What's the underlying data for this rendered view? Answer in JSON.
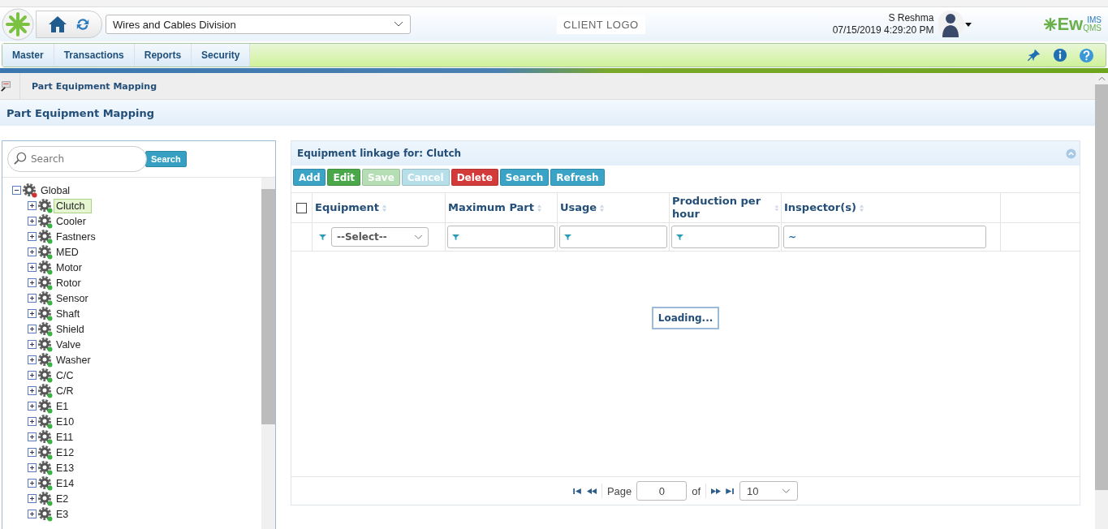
{
  "header": {
    "division": "Wires and Cables Division",
    "client_logo": "CLIENT LOGO",
    "user_name": "S Reshma",
    "datetime": "07/15/2019 4:29:20 PM",
    "brand": "Ew",
    "brand_sup": "IMS",
    "brand_sub": "QMS"
  },
  "menu": [
    "Master",
    "Transactions",
    "Reports",
    "Security"
  ],
  "breadcrumb": "Part Equipment Mapping",
  "page_title": "Part Equipment Mapping",
  "tree_panel": {
    "search": {
      "placeholder": "Search"
    },
    "search_button": "Search",
    "tree": [
      {
        "label": "Global",
        "expanded": true,
        "selected": false,
        "color": "#d03030",
        "children": [
          {
            "label": "Clutch",
            "expanded": false,
            "selected": true,
            "color": "#3cb043"
          },
          {
            "label": "Cooler",
            "expanded": false,
            "selected": false,
            "color": "#3cb043"
          },
          {
            "label": "Fastners",
            "expanded": false,
            "selected": false,
            "color": "#3cb043"
          },
          {
            "label": "MED",
            "expanded": false,
            "selected": false,
            "color": "#3cb043"
          },
          {
            "label": "Motor",
            "expanded": false,
            "selected": false,
            "color": "#3cb043"
          },
          {
            "label": "Rotor",
            "expanded": false,
            "selected": false,
            "color": "#3cb043"
          },
          {
            "label": "Sensor",
            "expanded": false,
            "selected": false,
            "color": "#3cb043"
          },
          {
            "label": "Shaft",
            "expanded": false,
            "selected": false,
            "color": "#3cb043"
          },
          {
            "label": "Shield",
            "expanded": false,
            "selected": false,
            "color": "#3cb043"
          },
          {
            "label": "Valve",
            "expanded": false,
            "selected": false,
            "color": "#3cb043"
          },
          {
            "label": "Washer",
            "expanded": false,
            "selected": false,
            "color": "#3cb043"
          },
          {
            "label": "C/C",
            "expanded": false,
            "selected": false,
            "color": "#3cb043"
          },
          {
            "label": "C/R",
            "expanded": false,
            "selected": false,
            "color": "#3cb043"
          },
          {
            "label": "E1",
            "expanded": false,
            "selected": false,
            "color": "#3cb043"
          },
          {
            "label": "E10",
            "expanded": false,
            "selected": false,
            "color": "#3cb043"
          },
          {
            "label": "E11",
            "expanded": false,
            "selected": false,
            "color": "#3cb043"
          },
          {
            "label": "E12",
            "expanded": false,
            "selected": false,
            "color": "#3cb043"
          },
          {
            "label": "E13",
            "expanded": false,
            "selected": false,
            "color": "#3cb043"
          },
          {
            "label": "E14",
            "expanded": false,
            "selected": false,
            "color": "#3cb043"
          },
          {
            "label": "E2",
            "expanded": false,
            "selected": false,
            "color": "#3cb043"
          },
          {
            "label": "E3",
            "expanded": false,
            "selected": false,
            "color": "#3cb043"
          }
        ]
      }
    ]
  },
  "grid": {
    "title": "Equipment linkage for: Clutch",
    "buttons": [
      {
        "label": "Add",
        "kind": "primary",
        "disabled": false
      },
      {
        "label": "Edit",
        "kind": "success",
        "disabled": false
      },
      {
        "label": "Save",
        "kind": "success",
        "disabled": true
      },
      {
        "label": "Cancel",
        "kind": "primary",
        "disabled": true
      },
      {
        "label": "Delete",
        "kind": "danger",
        "disabled": false
      },
      {
        "label": "Search",
        "kind": "primary",
        "disabled": false
      },
      {
        "label": "Refresh",
        "kind": "primary",
        "disabled": false
      }
    ],
    "select_all_checked": false,
    "columns": [
      {
        "label": "Equipment",
        "kind": "select",
        "value": "--Select--"
      },
      {
        "label": "Maximum Part",
        "kind": "text"
      },
      {
        "label": "Usage",
        "kind": "text"
      },
      {
        "label": "Production per hour",
        "kind": "text"
      },
      {
        "label": "Inspector(s)",
        "kind": "tilde",
        "value": "~"
      }
    ],
    "loading": "Loading...",
    "pager": {
      "page_label": "Page",
      "page": "0",
      "of_label": "of",
      "page_size": "10"
    }
  }
}
